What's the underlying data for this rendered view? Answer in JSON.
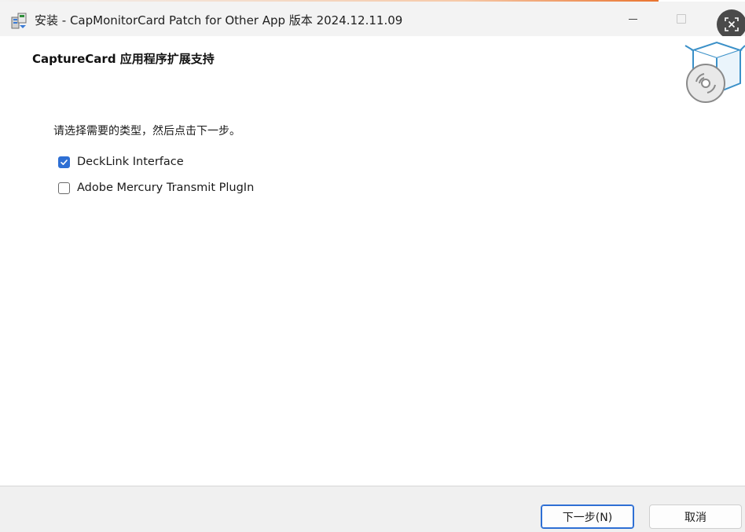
{
  "window": {
    "title": "安装 - CapMonitorCard Patch for Other App 版本 2024.12.11.09"
  },
  "header": {
    "heading": "CaptureCard 应用程序扩展支持",
    "icon": "software-box-disc-icon"
  },
  "main": {
    "instruction": "请选择需要的类型，然后点击下一步。",
    "options": [
      {
        "label": "DeckLink Interface",
        "checked": true
      },
      {
        "label": "Adobe Mercury Transmit PlugIn",
        "checked": false
      }
    ]
  },
  "footer": {
    "next_label": "下一步(N)",
    "cancel_label": "取消"
  },
  "colors": {
    "accent": "#2e6fd4",
    "titlebar": "#f3f3f3",
    "footer": "#f0f0f0"
  }
}
